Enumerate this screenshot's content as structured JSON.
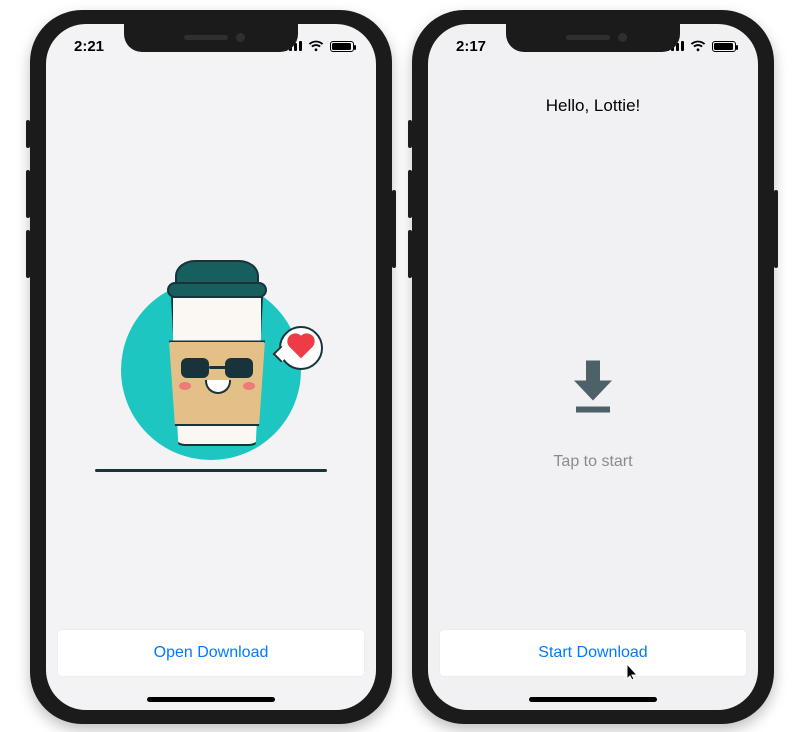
{
  "left": {
    "status": {
      "time": "2:21"
    },
    "cta_label": "Open Download"
  },
  "right": {
    "status": {
      "time": "2:17"
    },
    "title": "Hello, Lottie!",
    "hint": "Tap to start",
    "cta_label": "Start Download"
  },
  "colors": {
    "ios_blue": "#007aff",
    "teal": "#1ec6c1",
    "lid": "#175e5e",
    "sleeve": "#e4c089",
    "arrow": "#4d6168"
  },
  "icons": {
    "left_illustration": "coffee-cup-sunglasses-heart",
    "right_center": "download-arrow",
    "speech_bubble": "heart"
  }
}
